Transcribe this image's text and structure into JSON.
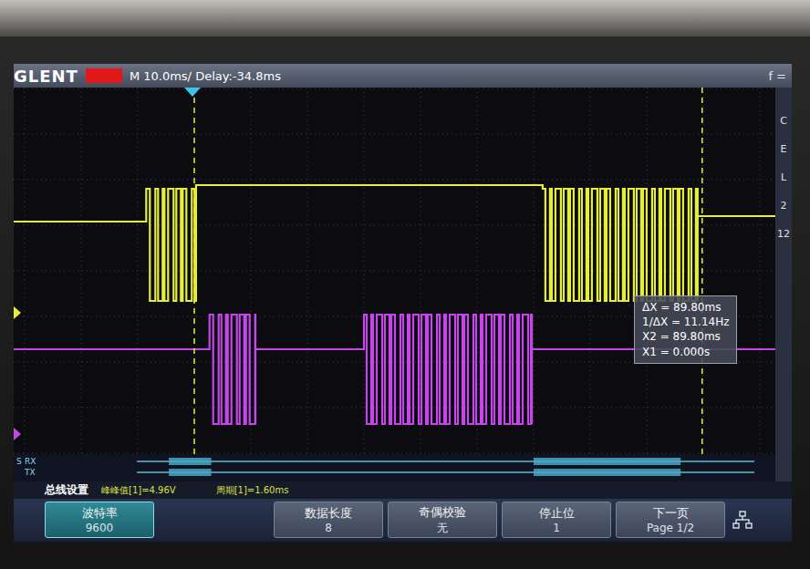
{
  "top_bar": {
    "brand": "GLENT",
    "timebase": "M 10.0ms/ Delay:-34.8ms",
    "freq_label": "f ="
  },
  "side_panel": [
    "C",
    "E",
    "L",
    "2",
    "12"
  ],
  "traces": [
    {
      "name": "1",
      "color": "#e6ee3a",
      "bursts_ms": [
        [
          -8.5,
          0.3
        ],
        [
          61.6,
          89.0
        ]
      ]
    },
    {
      "name": "2",
      "color": "#c448e8",
      "bursts_ms": [
        [
          2.7,
          10.8
        ],
        [
          30.0,
          59.7
        ]
      ]
    }
  ],
  "cursors_ms": [
    0,
    89.8
  ],
  "readout": [
    "ΔX = 89.80ms",
    "1/ΔX = 11.14Hz",
    "X2 = 89.80ms",
    "X1 = 0.000s"
  ],
  "bus": {
    "label": "S",
    "rows": [
      {
        "name": "RX",
        "segments_ms": [
          [
            -4.5,
            3.0
          ],
          [
            60.0,
            86.0
          ]
        ]
      },
      {
        "name": "TX",
        "segments_ms": [
          [
            -4.5,
            3.0
          ],
          [
            60.0,
            86.0
          ]
        ]
      }
    ]
  },
  "info": {
    "title": "总线设置",
    "measurements": [
      "峰峰值[1]=4.96V",
      "周期[1]=1.60ms"
    ]
  },
  "softkeys": [
    {
      "label": "波特率",
      "value": "9600",
      "selected": true
    },
    {
      "label": "数据长度",
      "value": "8",
      "selected": false
    },
    {
      "label": "奇偶校验",
      "value": "无",
      "selected": false
    },
    {
      "label": "停止位",
      "value": "1",
      "selected": false
    },
    {
      "label": "下一页",
      "value": "Page 1/2",
      "selected": false
    }
  ]
}
